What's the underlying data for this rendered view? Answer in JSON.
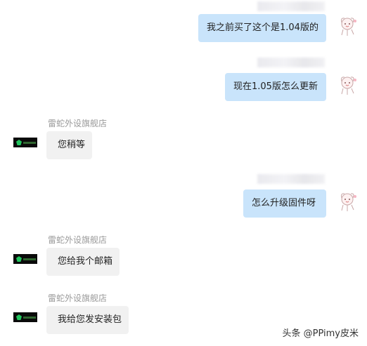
{
  "conversation": {
    "messages": [
      {
        "from": "me",
        "text": "我之前买了这个是1.04版的"
      },
      {
        "from": "me",
        "text": "现在1.05版怎么更新"
      },
      {
        "from": "shop",
        "sender": "雷蛇外设旗舰店",
        "text": "您稍等"
      },
      {
        "from": "me",
        "text": "怎么升级固件呀"
      },
      {
        "from": "shop",
        "sender": "雷蛇外设旗舰店",
        "text": "您给我个邮箱"
      },
      {
        "from": "shop",
        "sender": "雷蛇外设旗舰店",
        "text": "我给您发安装包"
      }
    ]
  },
  "icons": {
    "user_avatar": "user-avatar-icon",
    "shop_avatar": "razer-logo-icon"
  },
  "colors": {
    "my_bubble": "#c9e4fb",
    "their_bubble": "#f1f1f1",
    "sender_name": "#9a9a9a",
    "brand_green": "#22c55e"
  },
  "watermark": {
    "text": "头条 @PPimy皮米"
  }
}
